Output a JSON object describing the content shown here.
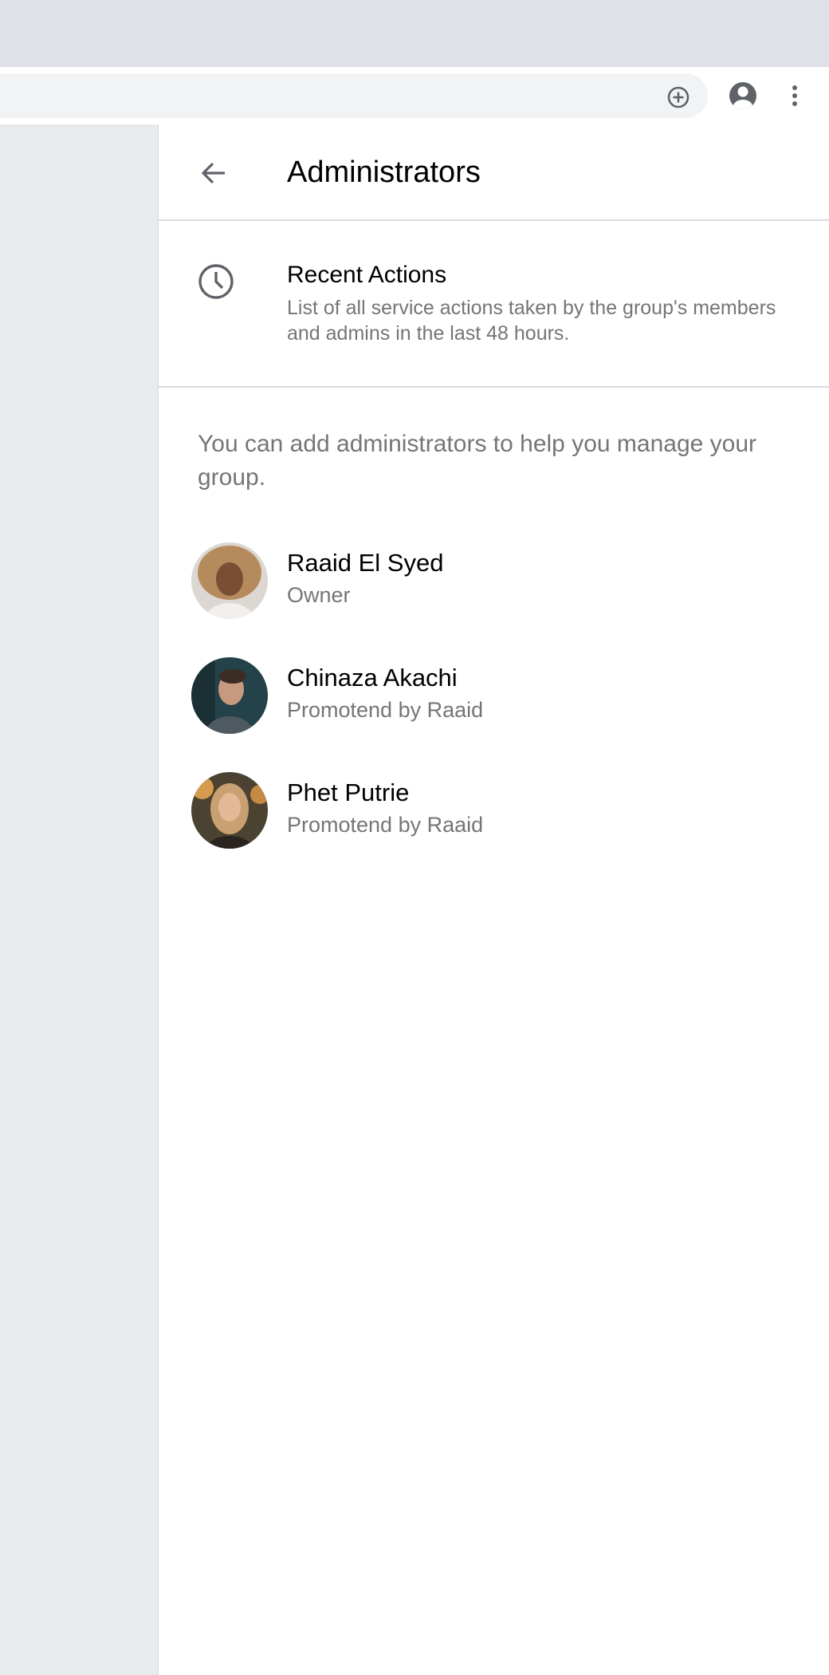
{
  "browser": {
    "add_icon": "add-circle-icon",
    "profile_icon": "account-circle-icon",
    "menu_icon": "more-vert-icon"
  },
  "header": {
    "title": "Administrators",
    "back_icon": "arrow-back-icon"
  },
  "recent_actions": {
    "icon": "clock-icon",
    "title": "Recent Actions",
    "description": "List of all service actions taken by the group's members and admins in the last 48 hours."
  },
  "hint": "You can add administrators to help you manage your group.",
  "admins": [
    {
      "name": "Raaid El Syed",
      "role": "Owner"
    },
    {
      "name": "Chinaza Akachi",
      "role": "Promotend by Raaid"
    },
    {
      "name": "Phet Putrie",
      "role": "Promotend by Raaid"
    }
  ],
  "colors": {
    "tabstrip": "#dee1e6",
    "omnibox": "#f1f3f4",
    "left_pane": "#e7ebee",
    "secondary_text": "#757575",
    "divider": "#dadce0"
  }
}
